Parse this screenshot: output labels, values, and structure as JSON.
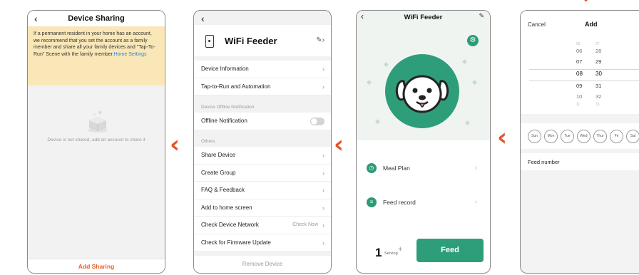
{
  "colors": {
    "accent_orange": "#e0552b",
    "feeder_green": "#2e9e7a",
    "notice_yellow": "#f9e7b7",
    "link_blue": "#2a86d6"
  },
  "sharing": {
    "back_icon": "chevron-left-icon",
    "title": "Device Sharing",
    "notice_text": "If a permanent resident in your home has an account, we recommend that you set the account as a family member and share all your family devices and \"Tap-To-Run\" Scene with the family member.",
    "notice_link": "Home Settings",
    "empty_text": "Device is not shared, add an account to share it",
    "add_button": "Add Sharing"
  },
  "settings": {
    "device_name": "WiFi Feeder",
    "rows_top": [
      {
        "label": "Device Information"
      },
      {
        "label": "Tap-to-Run and Automation"
      }
    ],
    "group_offline": "Device Offline Notification",
    "offline_row": "Offline Notification",
    "offline_enabled": false,
    "group_others": "Others",
    "rows_others": [
      {
        "label": "Share Device"
      },
      {
        "label": "Create Group"
      },
      {
        "label": "FAQ & Feedback"
      },
      {
        "label": "Add to home screen"
      }
    ],
    "check_network": {
      "label": "Check Device Network",
      "action": "Check Now"
    },
    "firmware_row": "Check for Firmware Update",
    "remove_button": "Remove Device"
  },
  "feeder": {
    "title": "WiFi Feeder",
    "menu": [
      {
        "label": "Meal Plan",
        "icon": "clock-icon"
      },
      {
        "label": "Feed record",
        "icon": "list-icon"
      }
    ],
    "quantity": "1",
    "quantity_unit": "Serving",
    "plus_label": "+",
    "feed_button": "Feed"
  },
  "add": {
    "cancel": "Cancel",
    "title": "Add",
    "picker_rows": [
      {
        "h": "05",
        "m": "27"
      },
      {
        "h": "06",
        "m": "28"
      },
      {
        "h": "07",
        "m": "29"
      },
      {
        "h": "08",
        "m": "30"
      },
      {
        "h": "09",
        "m": "31"
      },
      {
        "h": "10",
        "m": "32"
      },
      {
        "h": "11",
        "m": "33"
      }
    ],
    "days": [
      "Sun",
      "Mon",
      "Tue",
      "Wed",
      "Thur",
      "Fri",
      "Sat"
    ],
    "feed_number_label": "Feed number"
  }
}
